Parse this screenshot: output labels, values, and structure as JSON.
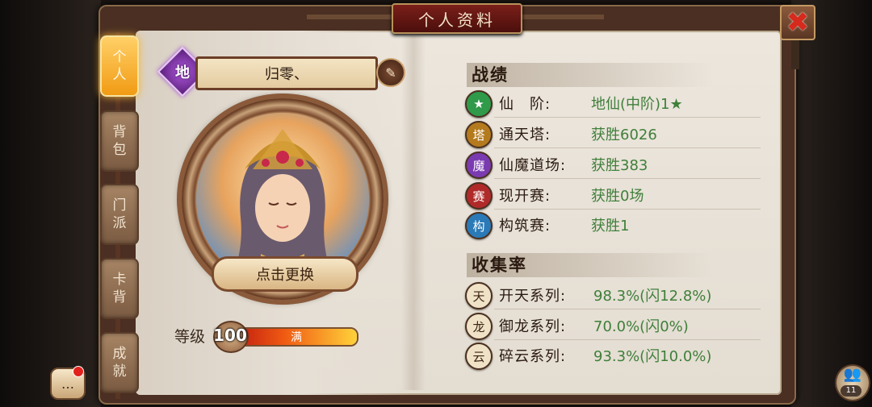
{
  "title": "个人资料",
  "close_icon": "✖",
  "tabs": [
    {
      "label_top": "个",
      "label_bottom": "人",
      "active": true
    },
    {
      "label_top": "背",
      "label_bottom": "包",
      "active": false
    },
    {
      "label_top": "门",
      "label_bottom": "派",
      "active": false
    },
    {
      "label_top": "卡",
      "label_bottom": "背",
      "active": false
    },
    {
      "label_top": "成",
      "label_bottom": "就",
      "active": false
    }
  ],
  "profile": {
    "rank_badge": "地",
    "name": "归零、",
    "edit_icon": "✎",
    "change_portrait": "点击更换",
    "level_label": "等级",
    "level_value": "100",
    "level_fill_percent": 100,
    "level_bar_text": "满"
  },
  "record_section": {
    "title": "战绩",
    "rows": [
      {
        "icon": "★",
        "icon_color": "#2f9a4a",
        "label": "仙　阶:",
        "value": "地仙(中阶)1★"
      },
      {
        "icon": "塔",
        "icon_color": "#b47a1e",
        "label": "通天塔:",
        "value": "获胜6026"
      },
      {
        "icon": "魔",
        "icon_color": "#7a3ab0",
        "label": "仙魔道场:",
        "value": "获胜383"
      },
      {
        "icon": "赛",
        "icon_color": "#b02a2a",
        "label": "现开赛:",
        "value": "获胜0场"
      },
      {
        "icon": "构",
        "icon_color": "#2a7ab8",
        "label": "构筑赛:",
        "value": "获胜1"
      }
    ]
  },
  "collection_section": {
    "title": "收集率",
    "rows": [
      {
        "icon": "天",
        "label": "开天系列:",
        "value": "98.3%(闪12.8%)"
      },
      {
        "icon": "龙",
        "label": "御龙系列:",
        "value": "70.0%(闪0%)"
      },
      {
        "icon": "云",
        "label": "碎云系列:",
        "value": "93.3%(闪10.0%)"
      }
    ]
  },
  "bottom": {
    "chat_icon": "…",
    "friends_icon": "👥",
    "friends_count": "11"
  }
}
